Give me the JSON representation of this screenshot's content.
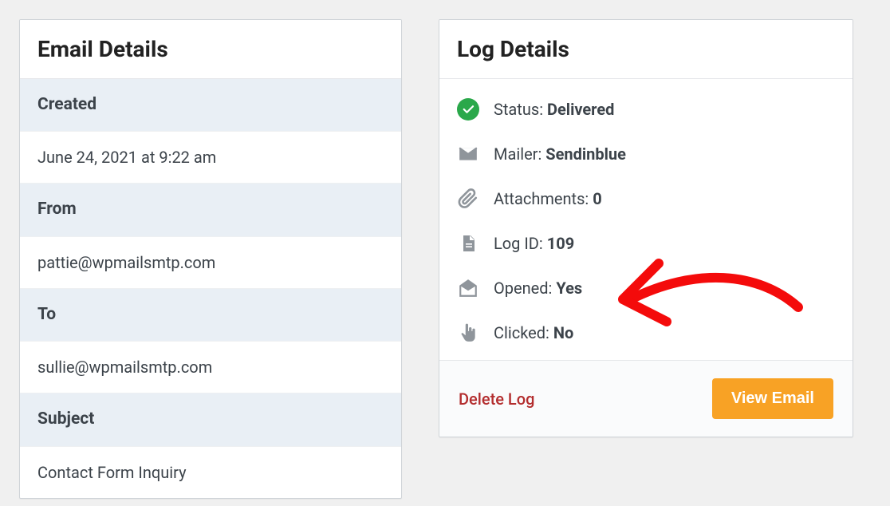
{
  "email_details": {
    "title": "Email Details",
    "created_label": "Created",
    "created_value": "June 24, 2021 at 9:22 am",
    "from_label": "From",
    "from_value": "pattie@wpmailsmtp.com",
    "to_label": "To",
    "to_value": "sullie@wpmailsmtp.com",
    "subject_label": "Subject",
    "subject_value": "Contact Form Inquiry"
  },
  "log_details": {
    "title": "Log Details",
    "status_label": "Status: ",
    "status_value": "Delivered",
    "mailer_label": "Mailer: ",
    "mailer_value": "Sendinblue",
    "attachments_label": "Attachments: ",
    "attachments_value": "0",
    "logid_label": "Log ID: ",
    "logid_value": "109",
    "opened_label": "Opened: ",
    "opened_value": "Yes",
    "clicked_label": "Clicked: ",
    "clicked_value": "No",
    "delete_label": "Delete Log",
    "view_label": "View Email"
  }
}
